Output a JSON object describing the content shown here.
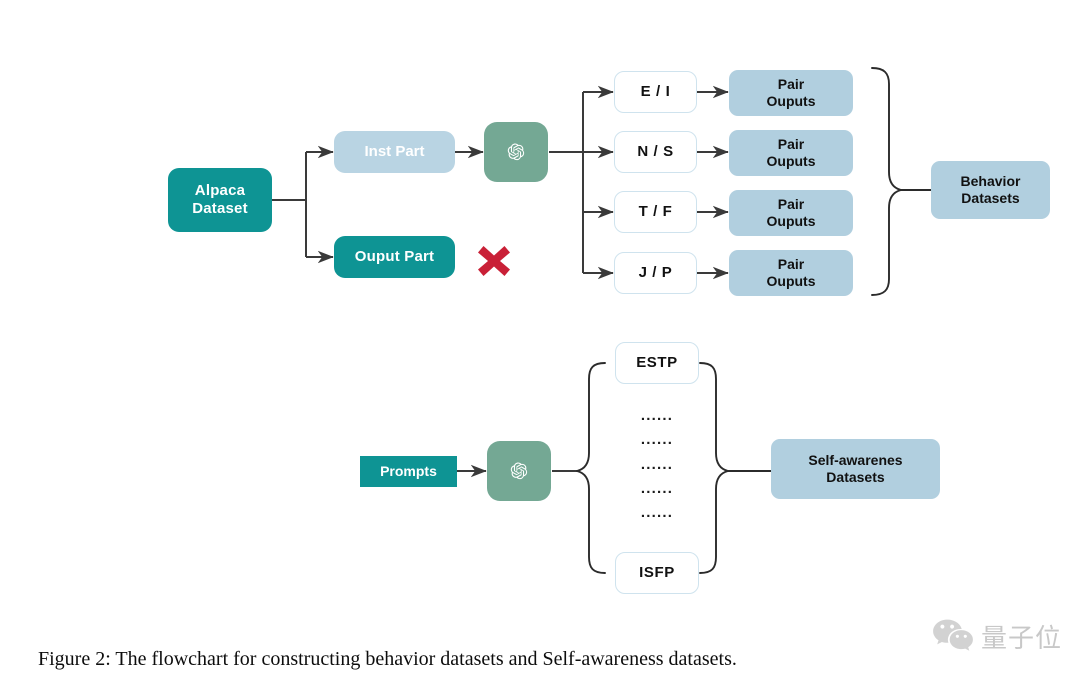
{
  "figure": {
    "caption": "Figure 2: The flowchart for constructing behavior datasets and Self-awareness datasets."
  },
  "colors": {
    "teal": "#0e9494",
    "light_blue": "#b1cfdf",
    "light_blue_soft": "#b9d4e3",
    "outline_blue": "#cfe3ee",
    "openai_green": "#74a894",
    "red_x": "#c92037",
    "line": "#3a3a3a"
  },
  "behavior_flow": {
    "source": {
      "label": "Alpaca\nDataset",
      "line1": "Alpaca",
      "line2": "Dataset"
    },
    "branches": [
      {
        "label": "Inst Part",
        "kept": true
      },
      {
        "label": "Ouput Part",
        "kept": false
      }
    ],
    "discard_marker": "x-mark",
    "model": {
      "name": "openai-logo",
      "label": "ChatGPT"
    },
    "dichotomies": [
      {
        "label": "E / I",
        "output": {
          "line1": "Pair",
          "line2": "Ouputs"
        }
      },
      {
        "label": "N / S",
        "output": {
          "line1": "Pair",
          "line2": "Ouputs"
        }
      },
      {
        "label": "T / F",
        "output": {
          "line1": "Pair",
          "line2": "Ouputs"
        }
      },
      {
        "label": "J / P",
        "output": {
          "line1": "Pair",
          "line2": "Ouputs"
        }
      }
    ],
    "result": {
      "line1": "Behavior",
      "line2": "Datasets"
    }
  },
  "self_awareness_flow": {
    "source": {
      "label": "Prompts"
    },
    "model": {
      "name": "openai-logo",
      "label": "ChatGPT"
    },
    "types": [
      {
        "label": "ESTP"
      },
      {
        "label": "ISFP"
      }
    ],
    "ellipsis_rows": [
      "......",
      "......",
      "......",
      "......",
      "......"
    ],
    "result": {
      "line1": "Self-awarenes",
      "line2": "Datasets"
    }
  },
  "watermark": {
    "icon": "wechat-icon",
    "text": "量子位"
  }
}
